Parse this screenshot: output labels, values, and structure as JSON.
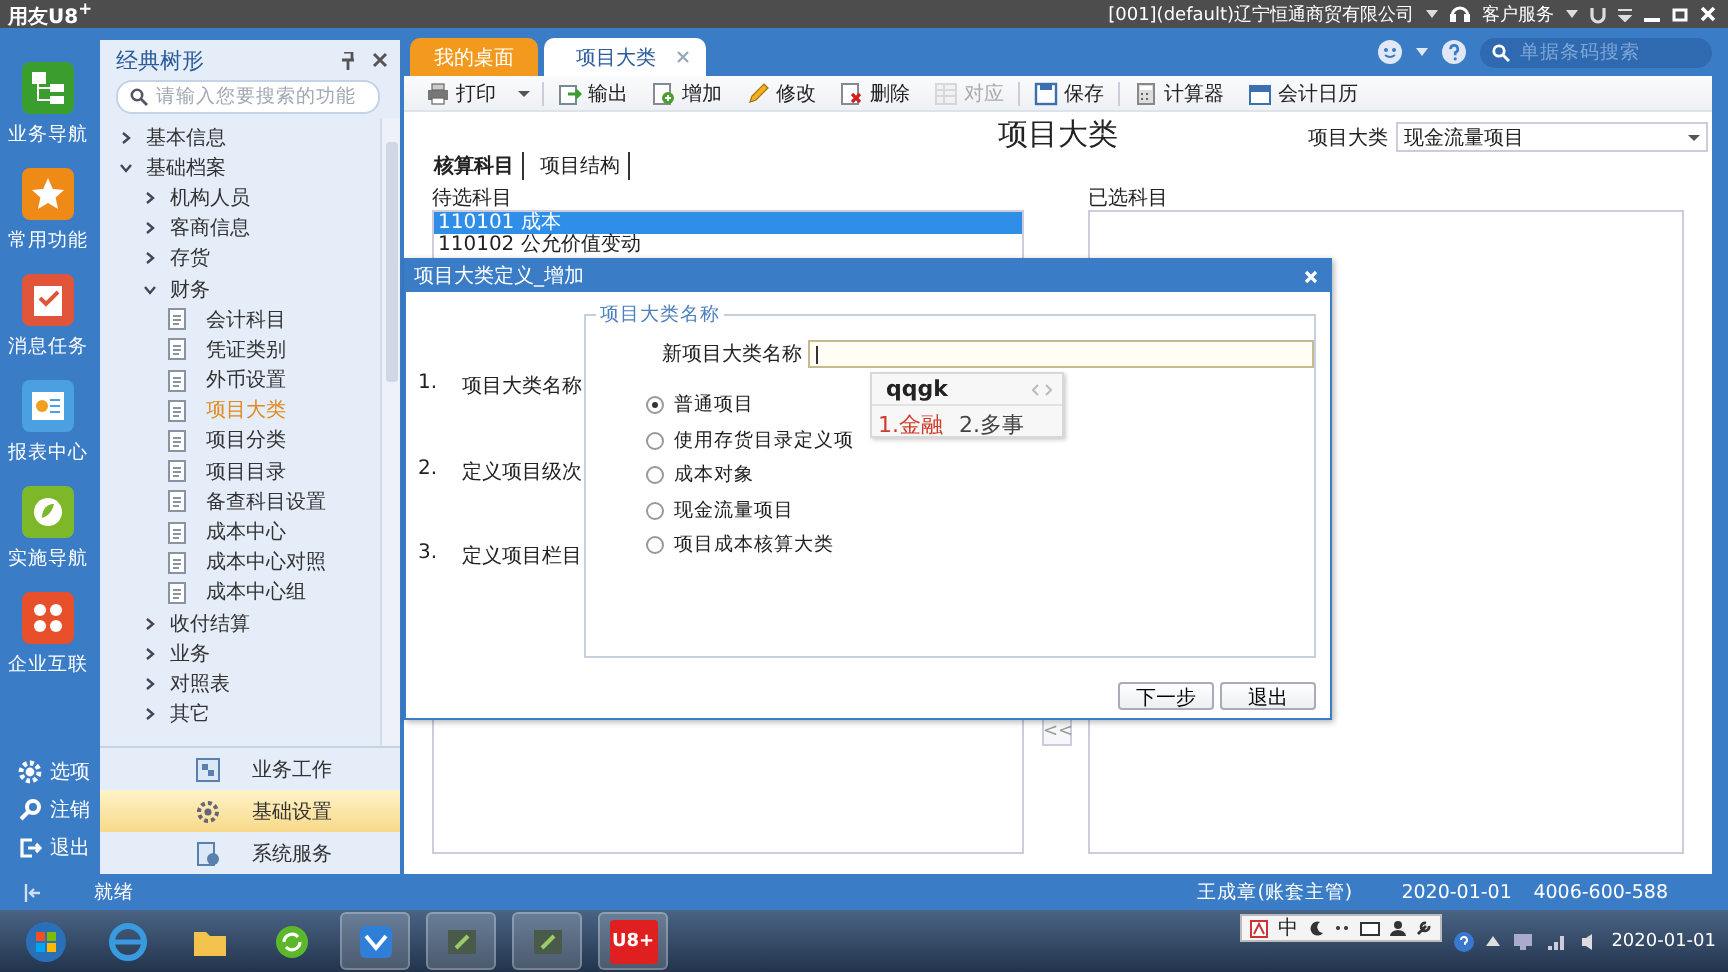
{
  "app_title": "用友U8$^{+}$",
  "title_bar": {
    "company": "[001](default)辽宁恒通商贸有限公司",
    "service": "客户服务"
  },
  "nav": [
    {
      "label": "业务导航",
      "kind": "tree",
      "color": "#3a9e2f"
    },
    {
      "label": "常用功能",
      "kind": "star",
      "color": "#f08a16"
    },
    {
      "label": "消息任务",
      "kind": "checklist",
      "color": "#e0553a"
    },
    {
      "label": "报表中心",
      "kind": "report",
      "color": "#4aa0e0"
    },
    {
      "label": "实施导航",
      "kind": "leaf",
      "color": "#7cb82a"
    },
    {
      "label": "企业互联",
      "kind": "network",
      "color": "#e8502c"
    }
  ],
  "nav_bottom": [
    {
      "label": "选项",
      "kind": "gear"
    },
    {
      "label": "注销",
      "kind": "key"
    },
    {
      "label": "退出",
      "kind": "exit"
    }
  ],
  "tree_panel": {
    "title": "经典树形",
    "search_placeholder": "请输入您要搜索的功能",
    "items": [
      {
        "label": "基本信息",
        "kind": "folder",
        "expanded": false,
        "selected": false
      },
      {
        "label": "基础档案",
        "kind": "folder",
        "expanded": true,
        "selected": false,
        "children": [
          {
            "label": "机构人员",
            "kind": "folder",
            "expanded": false,
            "selected": false
          },
          {
            "label": "客商信息",
            "kind": "folder",
            "expanded": false,
            "selected": false
          },
          {
            "label": "存货",
            "kind": "folder",
            "expanded": false,
            "selected": false
          },
          {
            "label": "财务",
            "kind": "folder",
            "expanded": true,
            "selected": false,
            "children": [
              {
                "label": "会计科目",
                "kind": "document",
                "selected": false
              },
              {
                "label": "凭证类别",
                "kind": "document",
                "selected": false
              },
              {
                "label": "外币设置",
                "kind": "document",
                "selected": false
              },
              {
                "label": "项目大类",
                "kind": "document",
                "selected": true
              },
              {
                "label": "项目分类",
                "kind": "document",
                "selected": false
              },
              {
                "label": "项目目录",
                "kind": "document",
                "selected": false
              },
              {
                "label": "备查科目设置",
                "kind": "document",
                "selected": false
              },
              {
                "label": "成本中心",
                "kind": "document",
                "selected": false
              },
              {
                "label": "成本中心对照",
                "kind": "document",
                "selected": false
              },
              {
                "label": "成本中心组",
                "kind": "document",
                "selected": false
              }
            ]
          },
          {
            "label": "收付结算",
            "kind": "folder",
            "expanded": false,
            "selected": false
          },
          {
            "label": "业务",
            "kind": "folder",
            "expanded": false,
            "selected": false
          },
          {
            "label": "对照表",
            "kind": "folder",
            "expanded": false,
            "selected": false
          },
          {
            "label": "其它",
            "kind": "folder",
            "expanded": false,
            "selected": false
          }
        ]
      }
    ]
  },
  "modules": [
    {
      "label": "业务工作",
      "kind": "work",
      "selected": false
    },
    {
      "label": "基础设置",
      "kind": "gear",
      "selected": true
    },
    {
      "label": "系统服务",
      "kind": "service",
      "selected": false
    }
  ],
  "tabs": [
    {
      "label": "我的桌面",
      "selected": false,
      "closable": false
    },
    {
      "label": "项目大类",
      "selected": true,
      "closable": true
    }
  ],
  "global_search": {
    "placeholder": "单据条码搜索"
  },
  "toolbar": [
    {
      "label": "打印",
      "kind": "print",
      "disabled": false,
      "dropdown": true
    },
    {
      "label": "输出",
      "kind": "export",
      "disabled": false,
      "dropdown": false
    },
    {
      "label": "增加",
      "kind": "add",
      "disabled": false,
      "dropdown": false
    },
    {
      "label": "修改",
      "kind": "edit",
      "disabled": false,
      "dropdown": false
    },
    {
      "label": "删除",
      "kind": "delete",
      "disabled": false,
      "dropdown": false
    },
    {
      "label": "对应",
      "kind": "link",
      "disabled": true,
      "dropdown": false
    },
    {
      "label": "保存",
      "kind": "save",
      "disabled": false,
      "dropdown": false
    },
    {
      "label": "计算器",
      "kind": "calculator",
      "disabled": false,
      "dropdown": false
    },
    {
      "label": "会计日历",
      "kind": "calendar",
      "disabled": false,
      "dropdown": false
    }
  ],
  "page": {
    "title": "项目大类",
    "category_label": "项目大类",
    "category_value": "现金流量项目",
    "sub_tabs": [
      {
        "label": "核算科目",
        "selected": true
      },
      {
        "label": "项目结构",
        "selected": false
      }
    ],
    "available": {
      "title": "待选科目",
      "rows": [
        {
          "text": "110101 成本",
          "selected": true
        },
        {
          "text": "110102 公允价值变动",
          "selected": false
        }
      ]
    },
    "chosen": {
      "title": "已选科目"
    },
    "move_button": "<<"
  },
  "dialog": {
    "title": "项目大类定义_增加",
    "steps": [
      {
        "number": "1.",
        "label": "项目大类名称"
      },
      {
        "number": "2.",
        "label": "定义项目级次"
      },
      {
        "number": "3.",
        "label": "定义项目栏目"
      }
    ],
    "group_title": "项目大类名称",
    "field_label": "新项目大类名称",
    "options": [
      {
        "label": "普通项目",
        "selected": true
      },
      {
        "label": "使用存货目录定义项",
        "selected": false
      },
      {
        "label": "成本对象",
        "selected": false
      },
      {
        "label": "现金流量项目",
        "selected": false
      },
      {
        "label": "项目成本核算大类",
        "selected": false
      }
    ],
    "buttons": [
      "下一步",
      "退出"
    ]
  },
  "ime": {
    "composition": "qqgk",
    "candidates": [
      {
        "text": "1.金融",
        "selected": true
      },
      {
        "text": "2.多事",
        "selected": false
      }
    ]
  },
  "status_bar": {
    "status": "就绪",
    "user": "王成章(账套主管)",
    "date": "2020-01-01",
    "phone": "4006-600-588"
  },
  "ime_toolbar": {
    "mode": "中"
  },
  "taskbar": {
    "apps": [
      {
        "kind": "start"
      },
      {
        "kind": "browser"
      },
      {
        "kind": "folder"
      },
      {
        "kind": "refresh"
      },
      {
        "kind": "mail"
      },
      {
        "kind": "app"
      },
      {
        "kind": "app"
      },
      {
        "kind": "u8",
        "label": "U8+"
      }
    ],
    "date": "2020-01-01"
  }
}
